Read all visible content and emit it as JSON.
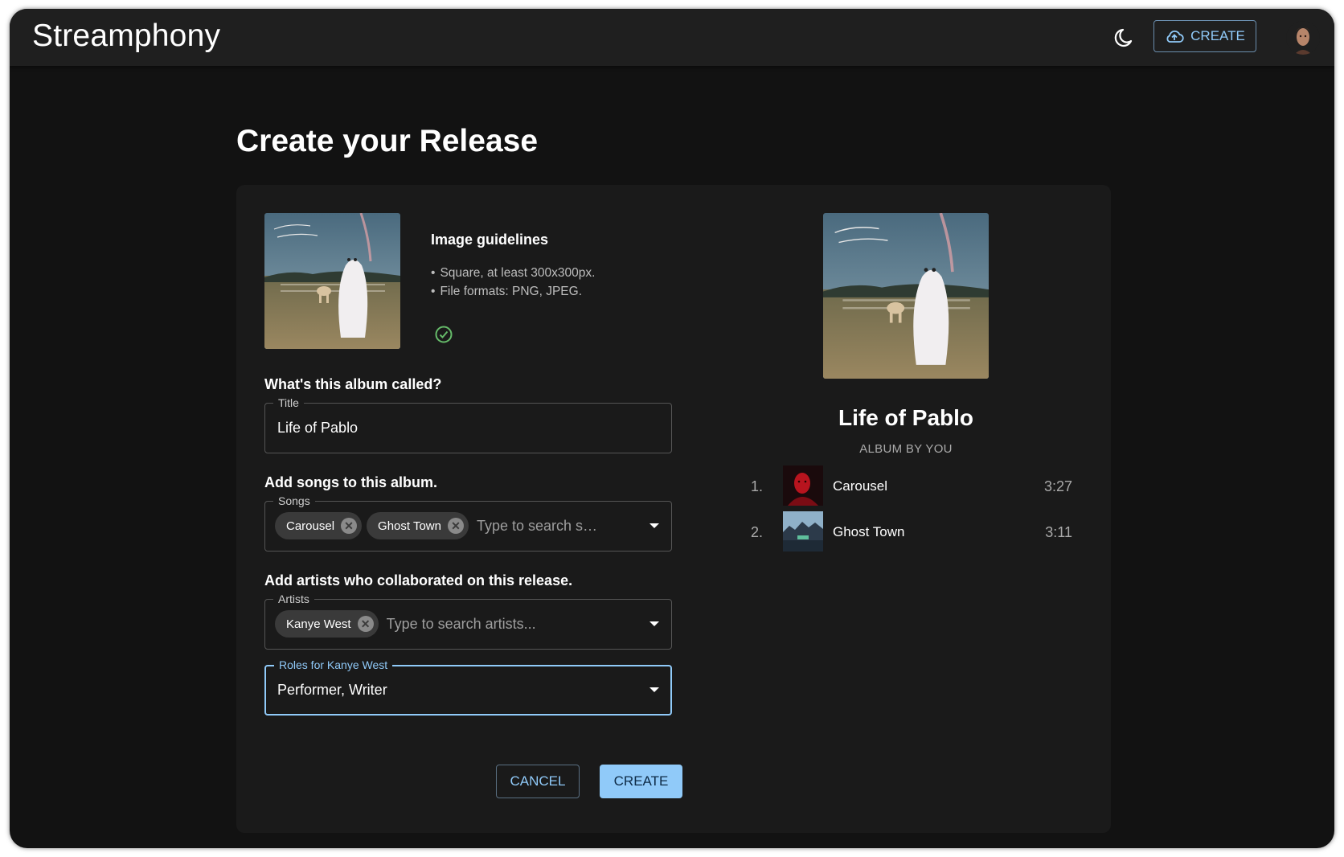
{
  "app": {
    "brand": "Streamphony",
    "create_label": "CREATE"
  },
  "page": {
    "title": "Create your Release"
  },
  "guidelines": {
    "title": "Image guidelines",
    "items": [
      "Square, at least 300x300px.",
      "File formats: PNG, JPEG."
    ]
  },
  "form": {
    "title_question": "What's this album called?",
    "title_legend": "Title",
    "title_value": "Life of Pablo",
    "songs_question": "Add songs to this album.",
    "songs_legend": "Songs",
    "songs_chips": [
      "Carousel",
      "Ghost Town"
    ],
    "songs_placeholder": "Type to search s…",
    "artists_question": "Add artists who collaborated on this release.",
    "artists_legend": "Artists",
    "artists_chips": [
      "Kanye West"
    ],
    "artists_placeholder": "Type to search artists...",
    "roles_legend": "Roles for Kanye West",
    "roles_value": "Performer, Writer",
    "cancel_label": "CANCEL",
    "create_label": "CREATE"
  },
  "preview": {
    "album_title": "Life of Pablo",
    "subtitle": "ALBUM BY YOU",
    "tracks": [
      {
        "num": "1.",
        "name": "Carousel",
        "duration": "3:27"
      },
      {
        "num": "2.",
        "name": "Ghost Town",
        "duration": "3:11"
      }
    ]
  },
  "colors": {
    "accent": "#90caf9",
    "background": "#121212",
    "card": "#1a1a1a",
    "appbar": "#1f1f1f",
    "success": "#66bb6a"
  }
}
